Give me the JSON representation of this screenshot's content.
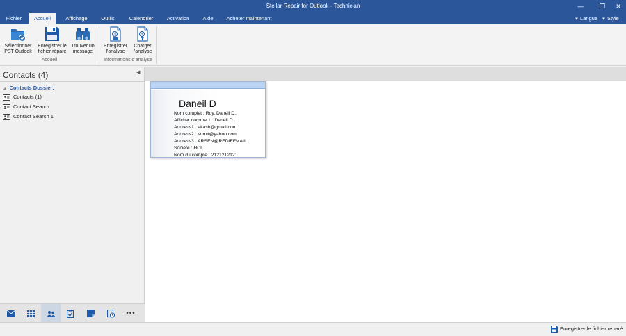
{
  "window": {
    "title": "Stellar Repair for Outlook - Technician",
    "controls": [
      "minimize-icon",
      "restore-icon",
      "close-icon"
    ]
  },
  "menubar": {
    "tabs": [
      "Fichier",
      "Accueil",
      "Affichage",
      "Outils",
      "Calendrier",
      "Activation",
      "Aide",
      "Acheter maintenant"
    ],
    "active_tab": "Accueil",
    "langue": "Langue",
    "style": "Style"
  },
  "ribbon": {
    "buttons": [
      {
        "label1": "Sélectionner",
        "label2": "PST Outlook",
        "icon": "folder-check-icon"
      },
      {
        "label1": "Enregistrer le",
        "label2": "fichier réparé",
        "icon": "floppy-disk-icon"
      },
      {
        "label1": "Trouver un",
        "label2": "message",
        "icon": "binoculars-icon"
      },
      {
        "label1": "Enregistrer",
        "label2": "l'analyse",
        "icon": "save-scan-icon"
      },
      {
        "label1": "Charger",
        "label2": "l'analyse",
        "icon": "load-scan-icon"
      }
    ],
    "groups": [
      "Accueil",
      "Informations d'analyse"
    ]
  },
  "left_panel": {
    "title": "Contacts (4)",
    "root": "Contacts Dossier:",
    "items": [
      "Contacts (1)",
      "Contact Search",
      "Contact Search 1"
    ]
  },
  "bottom_nav": [
    "mail-icon",
    "calendar-icon",
    "contacts-icon",
    "tasks-icon",
    "notes-icon",
    "journal-icon",
    "more-icon"
  ],
  "contact_card": {
    "name": "Daneil D",
    "fields": [
      "Nom complet : Roy, Daneil D..",
      "Afficher comme 1 : Daneil D..",
      "Address1 : akash@gmail.com",
      "Address2 : sumit@yahoo.com",
      "Address3 : ARSEN@REDIFFMAIL..",
      "Société : HCL",
      "Nom du compte : 2121212121"
    ]
  },
  "status": {
    "save_label": "Enregistrer le fichier réparé"
  },
  "colors": {
    "accent": "#2b579a",
    "card_header": "#bcd4f3"
  }
}
